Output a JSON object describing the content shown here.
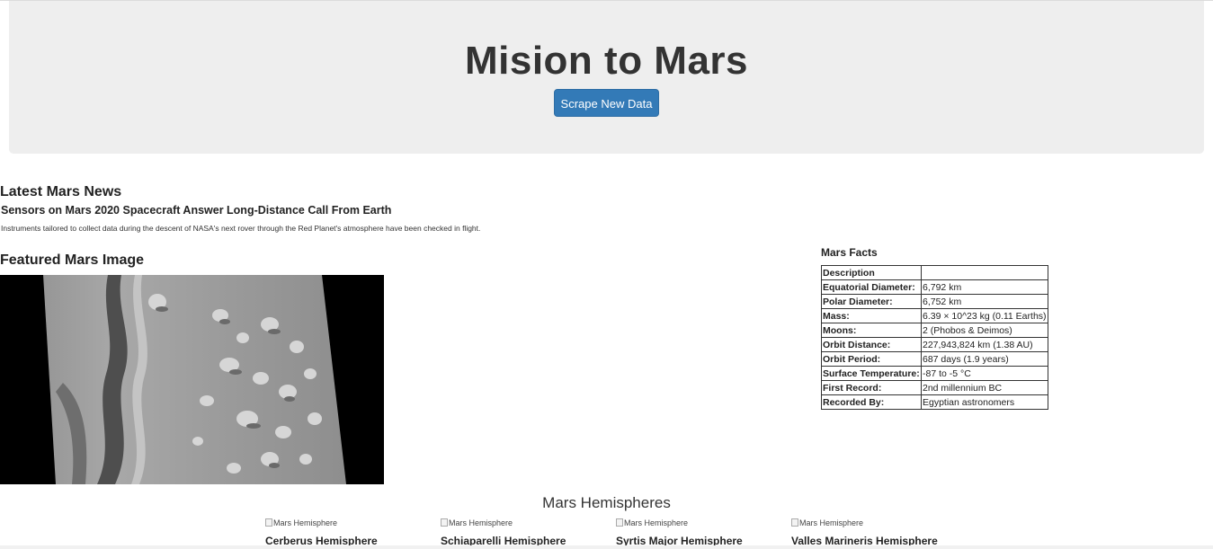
{
  "header": {
    "title": "Mision to Mars",
    "scrape_button": "Scrape New Data"
  },
  "news": {
    "heading": "Latest Mars News",
    "title": "Sensors on Mars 2020 Spacecraft Answer Long-Distance Call From Earth",
    "paragraph": "Instruments tailored to collect data during the descent of NASA's next rover through the Red Planet's atmosphere have been checked in flight."
  },
  "featured": {
    "heading": "Featured Mars Image"
  },
  "facts": {
    "heading": "Mars Facts",
    "rows": [
      {
        "label": "Description",
        "value": ""
      },
      {
        "label": "Equatorial Diameter:",
        "value": "6,792 km"
      },
      {
        "label": "Polar Diameter:",
        "value": "6,752 km"
      },
      {
        "label": "Mass:",
        "value": "6.39 × 10^23 kg (0.11 Earths)"
      },
      {
        "label": "Moons:",
        "value": "2 (Phobos & Deimos)"
      },
      {
        "label": "Orbit Distance:",
        "value": "227,943,824 km (1.38 AU)"
      },
      {
        "label": "Orbit Period:",
        "value": "687 days (1.9 years)"
      },
      {
        "label": "Surface Temperature:",
        "value": "-87 to -5 °C"
      },
      {
        "label": "First Record:",
        "value": "2nd millennium BC"
      },
      {
        "label": "Recorded By:",
        "value": "Egyptian astronomers"
      }
    ]
  },
  "hemispheres": {
    "heading": "Mars Hemispheres",
    "image_alt": "Mars Hemisphere",
    "items": [
      {
        "name": "Cerberus Hemisphere"
      },
      {
        "name": "Schiaparelli Hemisphere"
      },
      {
        "name": "Syrtis Major Hemisphere"
      },
      {
        "name": "Valles Marineris Hemisphere"
      }
    ]
  }
}
